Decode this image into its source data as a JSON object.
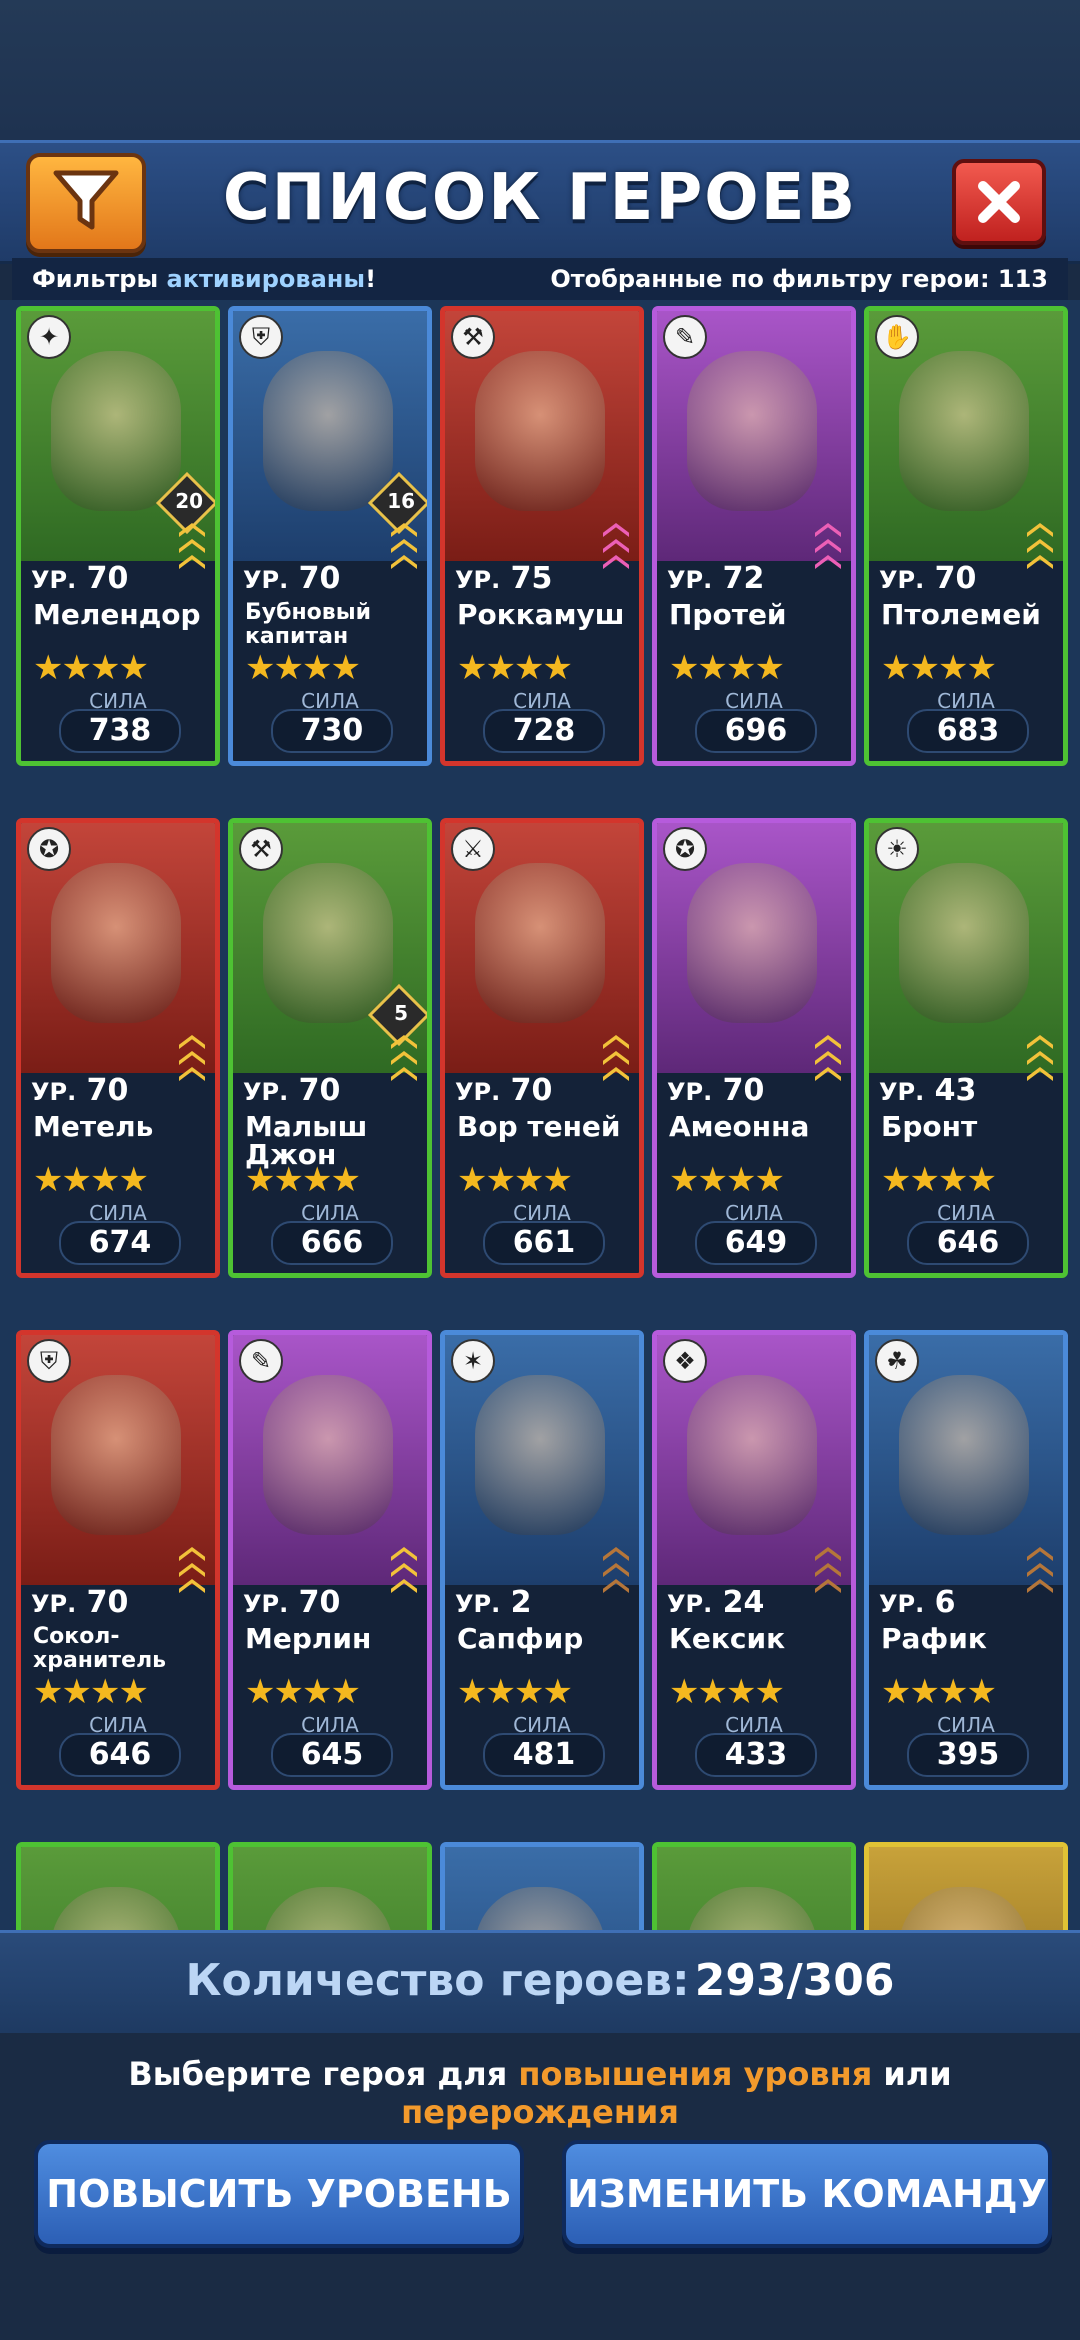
{
  "header": {
    "title": "СПИСОК ГЕРОЕВ",
    "filter_icon": "funnel-icon",
    "close_icon": "close-icon"
  },
  "filterbar": {
    "left_prefix": "Фильтры",
    "left_active": "активированы",
    "left_suffix": "!",
    "right": "Отобранные по фильтру герои: 113"
  },
  "level_prefix": "УР.",
  "power_label": "СИЛА",
  "stars": "★★★★",
  "heroes": [
    {
      "name": "Мелендор",
      "level": "70",
      "power": "738",
      "color": "green",
      "badge": "20",
      "rank": "yellow"
    },
    {
      "name": "Бубновый капитан",
      "level": "70",
      "power": "730",
      "color": "blue",
      "badge": "16",
      "rank": "yellow"
    },
    {
      "name": "Роккамуш",
      "level": "75",
      "power": "728",
      "color": "red",
      "badge": "",
      "rank": "pink"
    },
    {
      "name": "Протей",
      "level": "72",
      "power": "696",
      "color": "purple",
      "badge": "",
      "rank": "pink"
    },
    {
      "name": "Птолемей",
      "level": "70",
      "power": "683",
      "color": "green",
      "badge": "",
      "rank": "yellow"
    },
    {
      "name": "Метель",
      "level": "70",
      "power": "674",
      "color": "red",
      "badge": "",
      "rank": "yellow"
    },
    {
      "name": "Малыш Джон",
      "level": "70",
      "power": "666",
      "color": "green",
      "badge": "5",
      "rank": "yellow"
    },
    {
      "name": "Вор теней",
      "level": "70",
      "power": "661",
      "color": "red",
      "badge": "",
      "rank": "yellow"
    },
    {
      "name": "Амеонна",
      "level": "70",
      "power": "649",
      "color": "purple",
      "badge": "",
      "rank": "yellow"
    },
    {
      "name": "Бронт",
      "level": "43",
      "power": "646",
      "color": "green",
      "badge": "",
      "rank": "yellow"
    },
    {
      "name": "Сокол-хранитель",
      "level": "70",
      "power": "646",
      "color": "red",
      "badge": "",
      "rank": "yellow"
    },
    {
      "name": "Мерлин",
      "level": "70",
      "power": "645",
      "color": "purple",
      "badge": "",
      "rank": "yellow"
    },
    {
      "name": "Сапфир",
      "level": "2",
      "power": "481",
      "color": "blue",
      "badge": "",
      "rank": "bronze"
    },
    {
      "name": "Кексик",
      "level": "24",
      "power": "433",
      "color": "purple",
      "badge": "",
      "rank": "bronze"
    },
    {
      "name": "Рафик",
      "level": "6",
      "power": "395",
      "color": "blue",
      "badge": "",
      "rank": "bronze"
    }
  ],
  "partial_row_colors": [
    "green",
    "green",
    "blue",
    "green",
    "yellow"
  ],
  "footer": {
    "count_label": "Количество героев:",
    "count_value": "293/306",
    "hint_part1": "Выберите героя для ",
    "hint_hl1": "повышения уровня",
    "hint_part2": " или ",
    "hint_hl2": "перерождения",
    "btn_levelup": "ПОВЫСИТЬ УРОВЕНЬ",
    "btn_team": "ИЗМЕНИТЬ КОМАНДУ"
  }
}
